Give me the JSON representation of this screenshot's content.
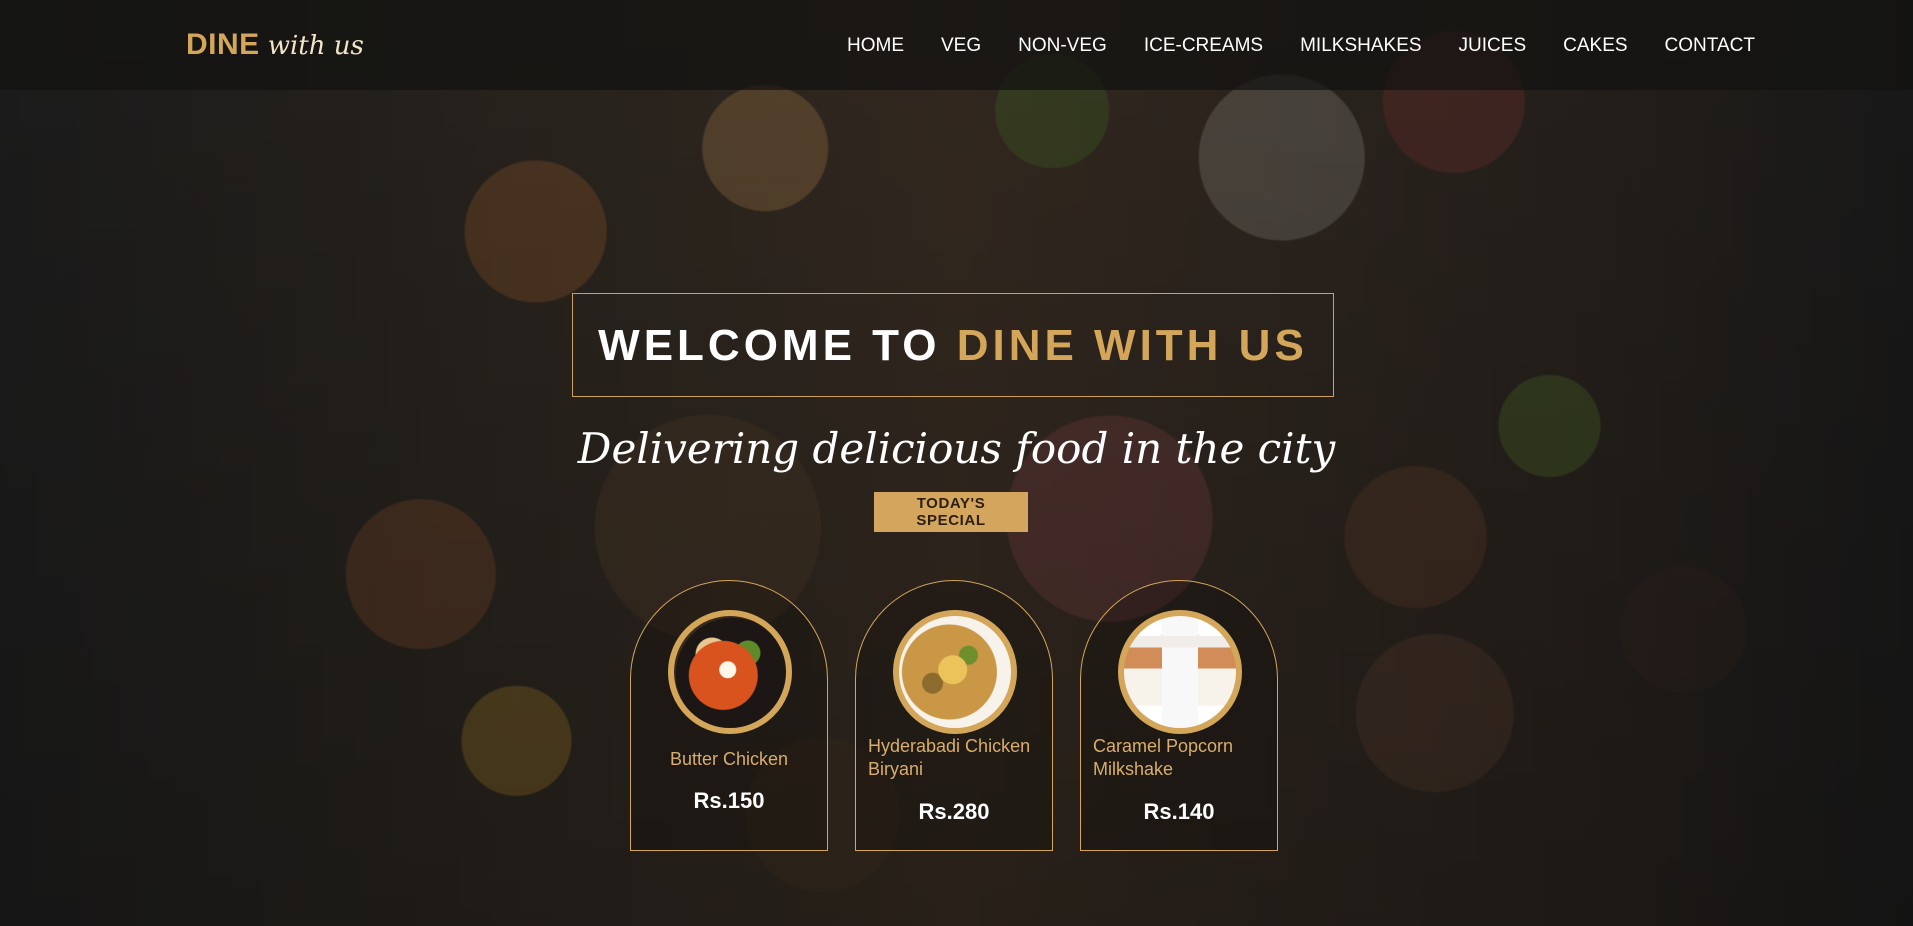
{
  "brand": {
    "main": "DINE",
    "sub": "with us"
  },
  "nav": {
    "items": [
      "HOME",
      "VEG",
      "NON-VEG",
      "ICE-CREAMS",
      "MILKSHAKES",
      "JUICES",
      "CAKES",
      "CONTACT"
    ]
  },
  "hero": {
    "title_white": "WELCOME TO",
    "title_gold": "DINE WITH US",
    "tagline": "Delivering delicious food in the city",
    "button": "TODAY'S  SPECIAL"
  },
  "specials": [
    {
      "name": "Butter Chicken",
      "price": "Rs.150",
      "image_icon": "butter-chicken-image"
    },
    {
      "name": "Hyderabadi Chicken Biryani",
      "price": "Rs.280",
      "image_icon": "biryani-image"
    },
    {
      "name": "Caramel Popcorn Milkshake",
      "price": "Rs.140",
      "image_icon": "milkshake-image"
    }
  ],
  "colors": {
    "gold": "#d3a65a",
    "white": "#ffffff",
    "nav_background": "#121210"
  }
}
